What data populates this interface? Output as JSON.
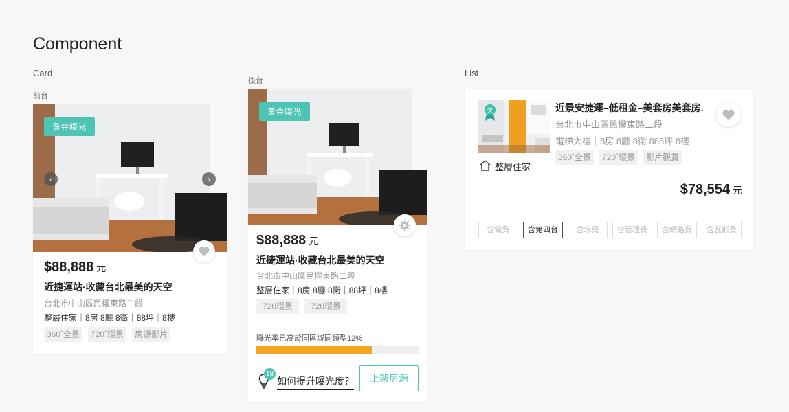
{
  "page": {
    "title": "Component"
  },
  "sections": {
    "card_label": "Card",
    "list_label": "List",
    "front_label": "前台",
    "back_label": "後台"
  },
  "front_card": {
    "badge": "黃金曝光",
    "price": "$88,888",
    "unit": "元",
    "title": "近捷運站·收藏台北最美的天空",
    "address": "台北市中山區民權東路二段",
    "specs": "整層住家｜8房 8廳 8衛｜88坪｜8樓",
    "tags": [
      "360˚全景",
      "720˚環景",
      "房源影片"
    ],
    "icons": {
      "prev": "chevron-left-icon",
      "next": "chevron-right-icon",
      "favorite": "heart-icon"
    }
  },
  "back_card": {
    "badge": "黃金曝光",
    "price": "$88,888",
    "unit": "元",
    "title": "近捷運站·收藏台北最美的天空",
    "address": "台北市中山區民權東路二段",
    "specs": "整層住家｜8房 8廳 8衛｜88坪｜8樓",
    "tags": [
      "720環景",
      "720環景"
    ],
    "exposure_text": "曝光率已高於同區域同類型12%",
    "exposure_percent": 71,
    "tip_count": "18",
    "tip_link": "如何提升曝光度？",
    "publish_button": "上架房源",
    "icons": {
      "settings": "gear-icon",
      "tip": "lightbulb-icon"
    }
  },
  "list_item": {
    "title": "近景安捷運–低租金–美套房美套房.",
    "address": "台北市中山區民權東路二段",
    "specs": "電梯大樓｜8房 8廳 8衛 888坪 8樓",
    "tags": [
      "360˚全景",
      "720˚環景",
      "影片觀賞"
    ],
    "type": "整層住家",
    "price": "$78,554",
    "unit": "元",
    "fees": [
      "含電費",
      "含第四台",
      "含水費",
      "含管理費",
      "含網路費",
      "含瓦斯費"
    ],
    "active_fee_index": 1,
    "icons": {
      "award": "award-ribbon-icon",
      "house": "house-icon",
      "favorite": "heart-icon"
    }
  },
  "colors": {
    "accent": "#4fc3b4",
    "progress": "#f5a623"
  }
}
